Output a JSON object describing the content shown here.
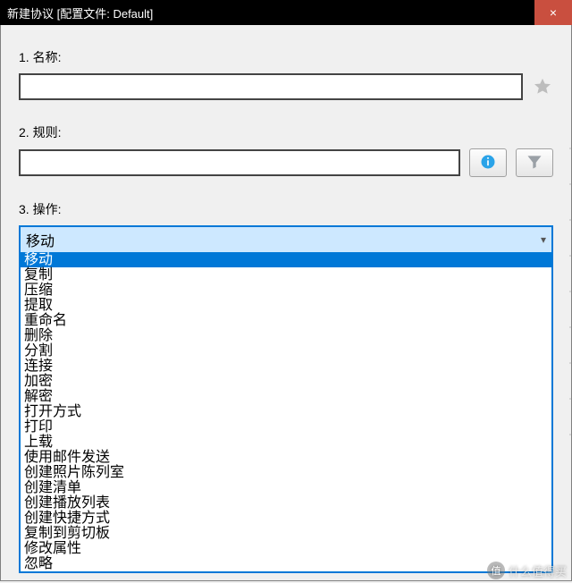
{
  "titlebar": {
    "title": "新建协议 [配置文件: Default]",
    "close_glyph": "×"
  },
  "section1": {
    "label": "1.  名称:",
    "value": "",
    "star_icon_name": "star-icon"
  },
  "section2": {
    "label": "2.  规则:",
    "value": "",
    "info_icon_name": "info-icon",
    "filter_icon_name": "funnel-icon"
  },
  "section3": {
    "label": "3.  操作:",
    "selected": "移动",
    "options": [
      "移动",
      "复制",
      "压缩",
      "提取",
      "重命名",
      "删除",
      "分割",
      "连接",
      "加密",
      "解密",
      "打开方式",
      "打印",
      "上载",
      "使用邮件发送",
      "创建照片陈列室",
      "创建清单",
      "创建播放列表",
      "创建快捷方式",
      "复制到剪切板",
      "修改属性",
      "忽略"
    ]
  },
  "watermark": {
    "text": "什么值得买",
    "badge": "值"
  }
}
